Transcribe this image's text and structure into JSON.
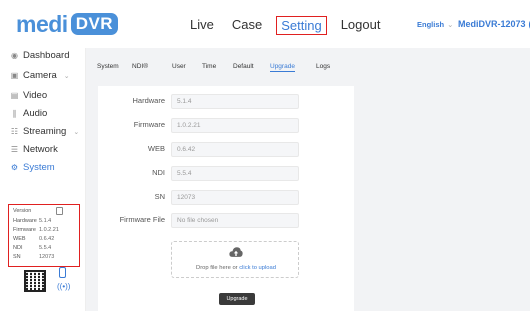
{
  "header": {
    "logo_text": "medi",
    "logo_box_text": "DVR",
    "nav": [
      "Live",
      "Case",
      "Setting",
      "Logout"
    ],
    "language": "English",
    "device_name": "MediDVR-12073",
    "device_name_tail": "(E"
  },
  "sidebar": {
    "items": [
      {
        "label": "Dashboard",
        "icon": "dashboard-icon"
      },
      {
        "label": "Camera",
        "icon": "camera-icon"
      },
      {
        "label": "Video",
        "icon": "video-icon"
      },
      {
        "label": "Audio",
        "icon": "audio-icon"
      },
      {
        "label": "Streaming",
        "icon": "streaming-icon"
      },
      {
        "label": "Network",
        "icon": "network-icon"
      },
      {
        "label": "System",
        "icon": "system-icon"
      }
    ],
    "version_info": {
      "title": "Version",
      "rows": [
        {
          "k": "Hardware",
          "v": "5.1.4"
        },
        {
          "k": "Firmware",
          "v": "1.0.2.21"
        },
        {
          "k": "WEB",
          "v": "0.6.42"
        },
        {
          "k": "NDI",
          "v": "5.5.4"
        },
        {
          "k": "SN",
          "v": "12073"
        }
      ]
    }
  },
  "tabs": [
    "System",
    "NDI®",
    "User",
    "Time",
    "Default",
    "Upgrade",
    "Logs"
  ],
  "active_tab": "Upgrade",
  "form": {
    "fields": [
      {
        "label": "Hardware",
        "value": "5.1.4"
      },
      {
        "label": "Firmware",
        "value": "1.0.2.21"
      },
      {
        "label": "WEB",
        "value": "0.6.42"
      },
      {
        "label": "NDI",
        "value": "5.5.4"
      },
      {
        "label": "SN",
        "value": "12073"
      },
      {
        "label": "Firmware File",
        "value": "No file chosen"
      }
    ],
    "upload_text": "Drop file here or ",
    "upload_link": "click to upload",
    "upgrade_button": "Upgrade"
  },
  "colors": {
    "accent": "#3a7bd5",
    "highlight": "#e02020"
  }
}
